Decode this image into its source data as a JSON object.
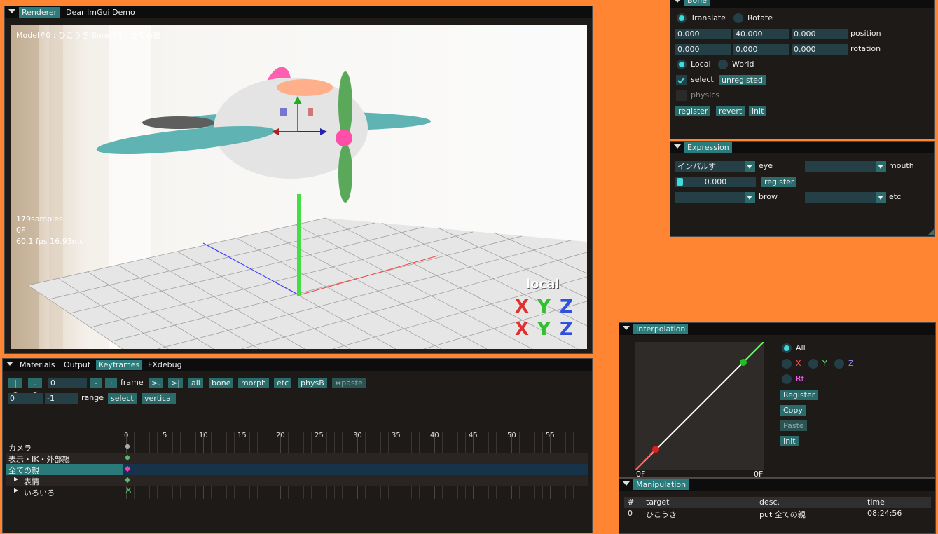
{
  "renderer": {
    "tabs": [
      "Renderer",
      "Dear ImGui Demo"
    ],
    "overlay_title": "Model#0 : ひこうき Bone#0 : 全ての親",
    "samples": "179samples",
    "frame": "0F",
    "fps": "60.1 fps 16.93ms",
    "axis_label": "local",
    "axis_letters": [
      "X",
      "Y",
      "Z"
    ]
  },
  "bone": {
    "title": "Bone",
    "translate": "Translate",
    "rotate": "Rotate",
    "position_values": [
      "0.000",
      "40.000",
      "0.000"
    ],
    "position_label": "position",
    "rotation_values": [
      "0.000",
      "0.000",
      "0.000"
    ],
    "rotation_label": "rotation",
    "local": "Local",
    "world": "World",
    "select": "select",
    "unregisted": "unregisted",
    "physics": "physics",
    "register": "register",
    "revert": "revert",
    "init": "init"
  },
  "expression": {
    "title": "Expression",
    "eye_value": "インパルす",
    "eye_label": "eye",
    "mouth_label": "mouth",
    "slider_value": "0.000",
    "register": "register",
    "brow_label": "brow",
    "etc_label": "etc"
  },
  "keyframes": {
    "tabs": [
      "Materials",
      "Output",
      "Keyframes",
      "FXdebug"
    ],
    "btn_first": "|<",
    "btn_prev": ".<",
    "frame_value": "0",
    "btn_minus": "-",
    "btn_plus": "+",
    "frame_label": "frame",
    "btn_next": ">.",
    "btn_last": ">|",
    "btn_all": "all",
    "btn_bone": "bone",
    "btn_morph": "morph",
    "btn_etc": "etc",
    "btn_physb": "physB",
    "btn_paste": "⇔paste",
    "range_start": "0",
    "range_end": "-1",
    "range_label": "range",
    "btn_select": "select",
    "btn_vertical": "vertical",
    "ruler": [
      "0",
      "5",
      "10",
      "15",
      "20",
      "25",
      "30",
      "35",
      "40",
      "45",
      "50",
      "55"
    ],
    "rows": [
      "カメラ",
      "表示・IK・外部親",
      "全ての親",
      "表情",
      "いろいろ"
    ]
  },
  "interpolation": {
    "title": "Interpolation",
    "all": "All",
    "x": "X",
    "y": "Y",
    "z": "Z",
    "rt": "Rt",
    "register": "Register",
    "copy": "Copy",
    "paste": "Paste",
    "init": "Init",
    "start_label": "0F",
    "end_label": "0F",
    "colors": {
      "x": "#ff5a5a",
      "y": "#6ee06e",
      "z": "#8a8aff",
      "rt": "#ff66ff"
    }
  },
  "manipulation": {
    "title": "Manipulation",
    "headers": [
      "#",
      "target",
      "desc.",
      "time"
    ],
    "rows": [
      [
        "0",
        "ひこうき",
        "put 全ての親",
        "08:24:56"
      ]
    ]
  }
}
